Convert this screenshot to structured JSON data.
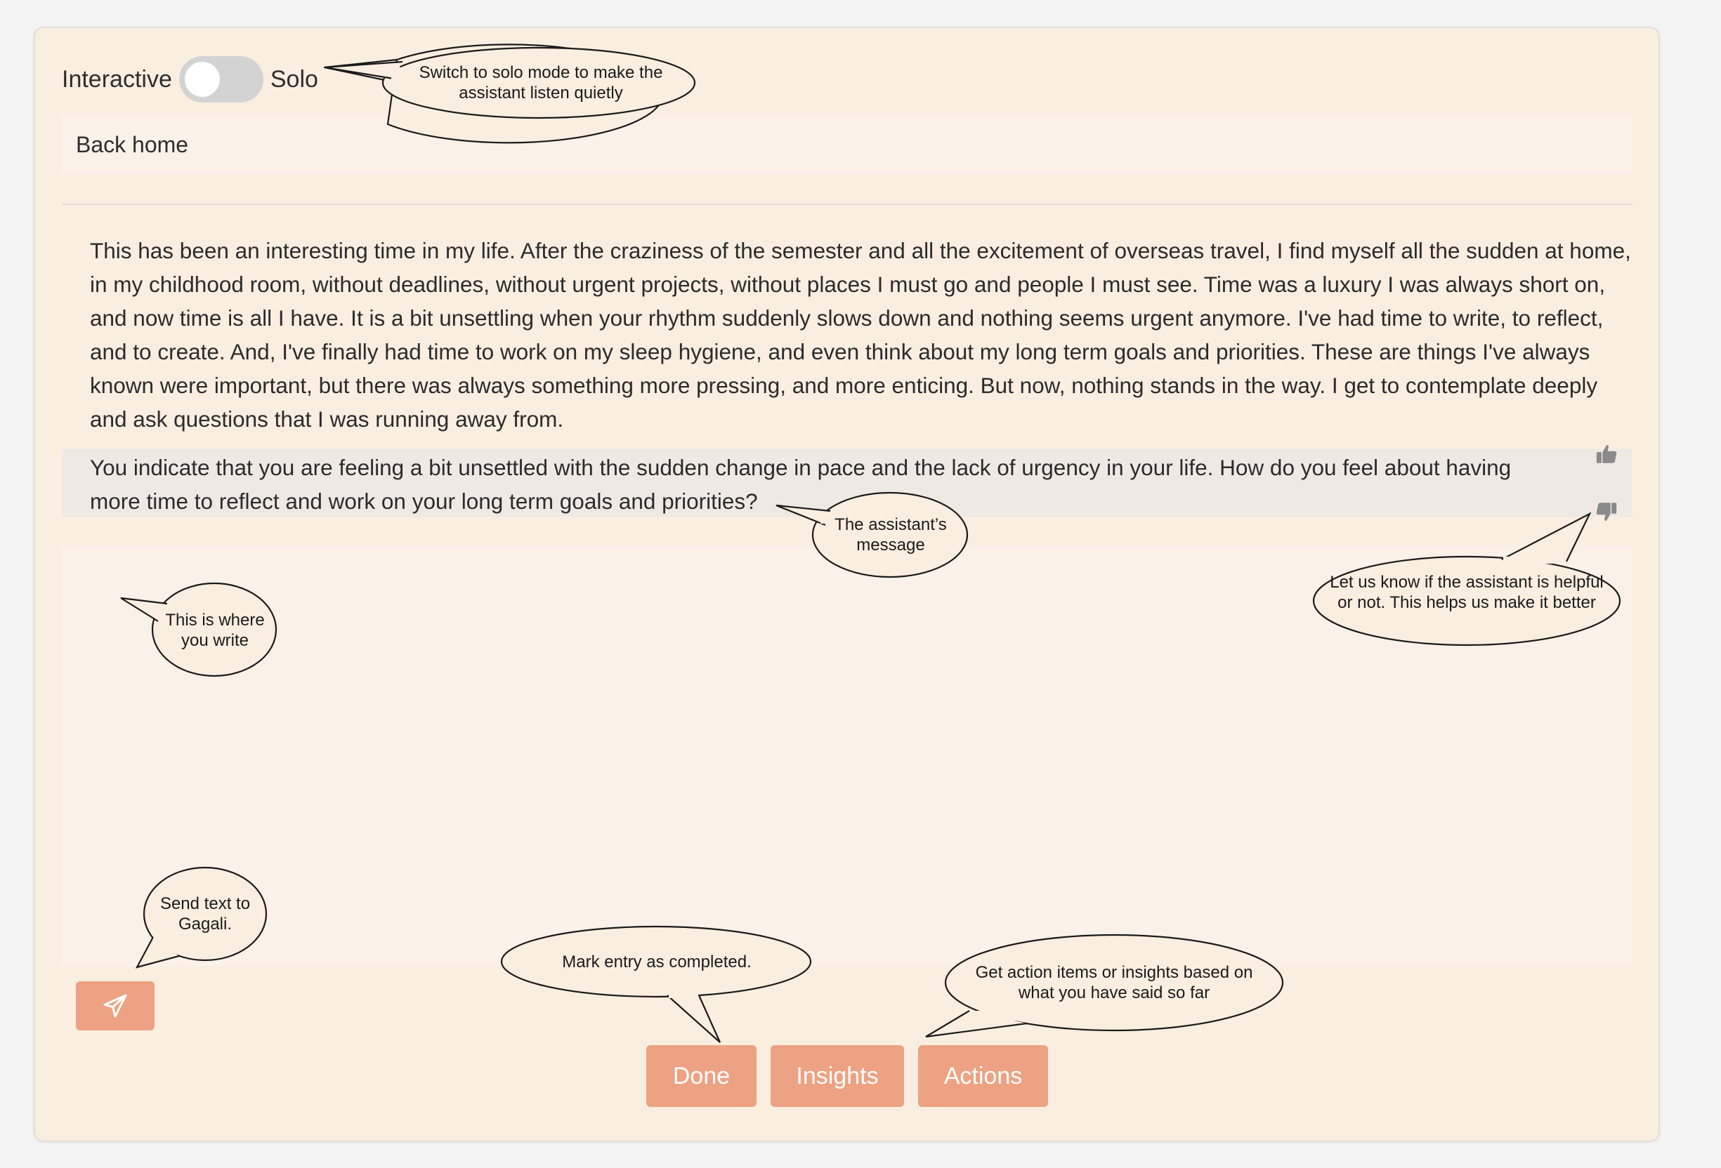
{
  "mode_switch": {
    "left_label": "Interactive",
    "right_label": "Solo",
    "is_solo": false
  },
  "entry": {
    "title": "Back home",
    "body": "This has been an interesting time in my life. After the craziness of the semester and all the excitement of overseas travel, I find myself all the sudden at home, in my childhood room, without deadlines, without urgent projects, without places I must go and people I must see. Time was a luxury I was always short on, and now time is all I have. It is a bit unsettling when your rhythm suddenly slows down and nothing seems urgent anymore. I've had time to write, to reflect, and to create. And, I've finally had time to work on my sleep hygiene, and even think about my long term goals and priorities. These are things I've always known were important, but there was always something more pressing, and more enticing. But now, nothing stands in the way. I get to contemplate deeply and ask questions that I was running away from."
  },
  "assistant": {
    "message": "You indicate that you are feeling a bit unsettled with the sudden change in pace and the lack of urgency in your life. How do you feel about having more time to reflect and work on your long term goals and priorities?"
  },
  "write_area": {
    "value": ""
  },
  "buttons": {
    "done": "Done",
    "insights": "Insights",
    "actions": "Actions"
  },
  "icons": {
    "send": "paper-plane-icon",
    "thumbs_up": "thumbs-up-icon",
    "thumbs_down": "thumbs-down-icon"
  },
  "callouts": {
    "solo_mode": "Switch  to solo mode to make the assistant listen quietly",
    "assistant_message": "The assistant’s message",
    "feedback": "Let us know if the assistant is helpful or not. This helps us make it better",
    "write_here": "This is where you write",
    "send_text": "Send text to Gagali.",
    "mark_done": "Mark entry as completed.",
    "insights_actions": "Get action items or insights based on what you have said so far"
  },
  "colors": {
    "card_background": "#faeee0",
    "button_accent": "#eda283",
    "assistant_background": "#efe9e4"
  }
}
